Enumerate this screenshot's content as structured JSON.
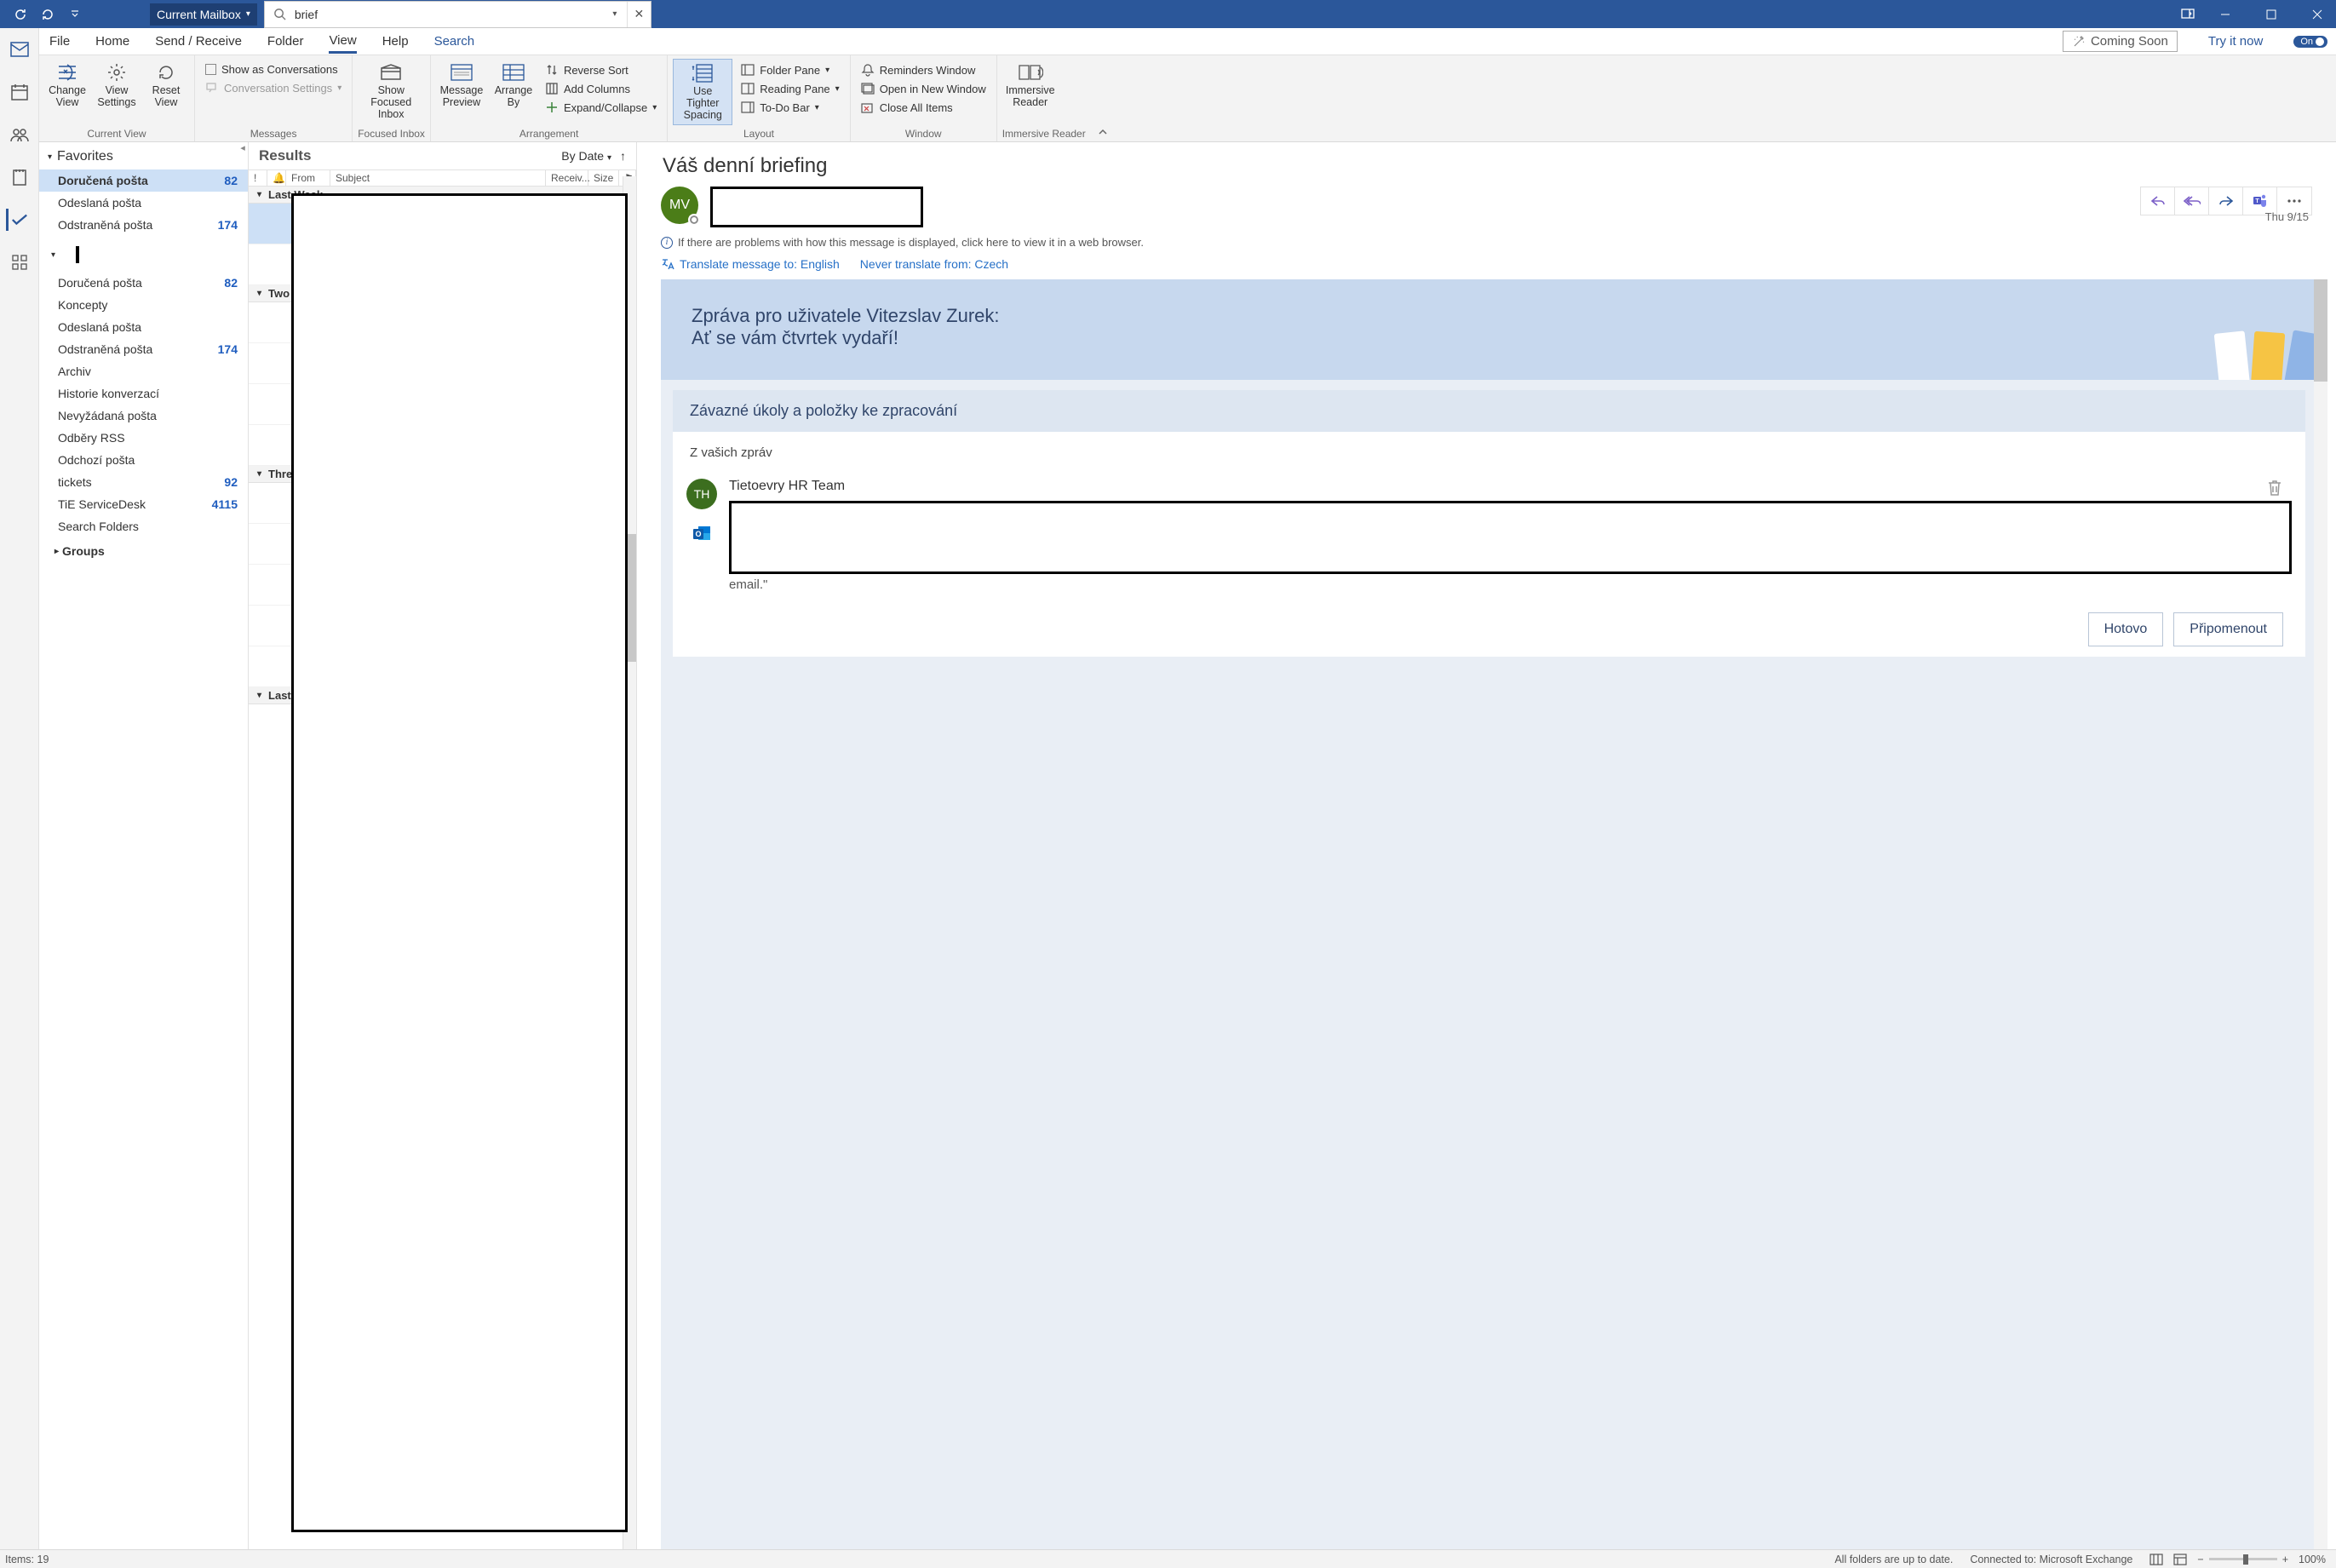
{
  "titlebar": {
    "mailbox_selector": "Current Mailbox",
    "search_value": "brief"
  },
  "tabs": {
    "file": "File",
    "home": "Home",
    "send_receive": "Send / Receive",
    "folder": "Folder",
    "view": "View",
    "help": "Help",
    "search": "Search",
    "coming_soon": "Coming Soon",
    "try_it_now": "Try it now",
    "toggle": "On"
  },
  "ribbon": {
    "current_view": {
      "change_view": "Change View",
      "view_settings": "View Settings",
      "reset_view": "Reset View",
      "label": "Current View"
    },
    "messages": {
      "show_as_conversations": "Show as Conversations",
      "conversation_settings": "Conversation Settings",
      "label": "Messages"
    },
    "focused": {
      "show_focused_inbox": "Show Focused Inbox",
      "label": "Focused Inbox"
    },
    "arrangement": {
      "message_preview": "Message Preview",
      "arrange_by": "Arrange By",
      "reverse_sort": "Reverse Sort",
      "add_columns": "Add Columns",
      "expand_collapse": "Expand/Collapse",
      "label": "Arrangement"
    },
    "layout": {
      "use_tighter_spacing": "Use Tighter Spacing",
      "folder_pane": "Folder Pane",
      "reading_pane": "Reading Pane",
      "todo_bar": "To-Do Bar",
      "label": "Layout"
    },
    "window": {
      "reminders": "Reminders Window",
      "new_window": "Open in New Window",
      "close_all": "Close All Items",
      "label": "Window"
    },
    "immersive": {
      "immersive_reader": "Immersive Reader",
      "label": "Immersive Reader"
    }
  },
  "folders": {
    "favorites": "Favorites",
    "items": [
      {
        "name": "Doručená pošta",
        "count": "82",
        "selected": true
      },
      {
        "name": "Odeslaná pošta",
        "count": ""
      },
      {
        "name": "Odstraněná pošta",
        "count": "174"
      }
    ],
    "account_items": [
      {
        "name": "Doručená pošta",
        "count": "82"
      },
      {
        "name": "Koncepty",
        "count": ""
      },
      {
        "name": "Odeslaná pošta",
        "count": ""
      },
      {
        "name": "Odstraněná pošta",
        "count": "174"
      },
      {
        "name": "Archiv",
        "count": ""
      },
      {
        "name": "Historie konverzací",
        "count": ""
      },
      {
        "name": "Nevyžádaná pošta",
        "count": ""
      },
      {
        "name": "Odběry RSS",
        "count": ""
      },
      {
        "name": "Odchozí pošta",
        "count": ""
      },
      {
        "name": "tickets",
        "count": "92"
      },
      {
        "name": "TiE ServiceDesk",
        "count": "4115"
      },
      {
        "name": "Search Folders",
        "count": ""
      }
    ],
    "groups": "Groups"
  },
  "results": {
    "title": "Results",
    "by_date": "By Date",
    "cols": {
      "from": "From",
      "subject": "Subject",
      "received": "Receiv...",
      "size": "Size"
    },
    "groups": [
      "Last Week",
      "Two",
      "Thre",
      "Last"
    ]
  },
  "reading": {
    "subject": "Váš denní briefing",
    "avatar_initials": "MV",
    "date": "Thu 9/15",
    "info": "If there are problems with how this message is displayed, click here to view it in a web browser.",
    "translate_to": "Translate message to: English",
    "never_translate": "Never translate from: Czech",
    "briefing_line1": "Zpráva pro uživatele Vitezslav Zurek:",
    "briefing_line2": "Ať se vám čtvrtek vydaří!",
    "card_header": "Závazné úkoly a položky ke zpracování",
    "card_sub": "Z vašich zpráv",
    "item_avatar": "TH",
    "item_sender": "Tietoevry HR Team",
    "item_tail": "email.\"",
    "btn_done": "Hotovo",
    "btn_remind": "Připomenout"
  },
  "status": {
    "items": "Items: 19",
    "up_to_date": "All folders are up to date.",
    "connected": "Connected to: Microsoft Exchange",
    "zoom": "100%"
  }
}
